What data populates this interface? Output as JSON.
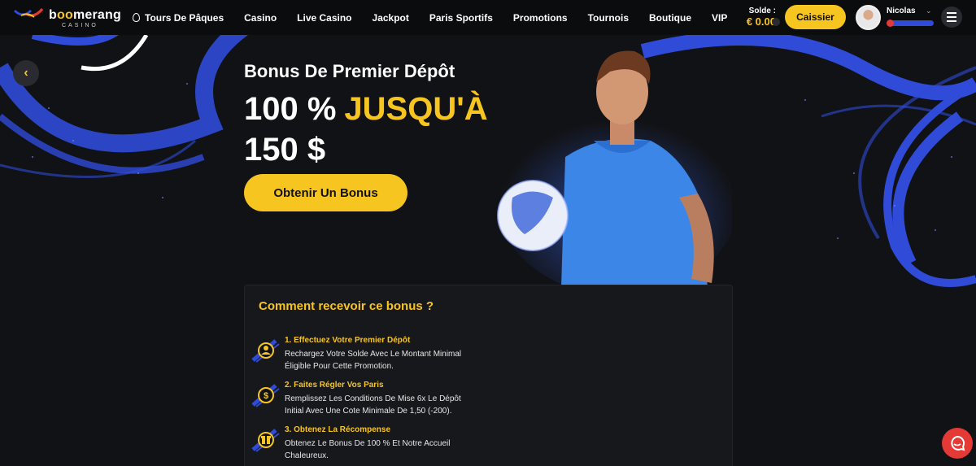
{
  "brand": {
    "name_prefix": "b",
    "name_o": "oo",
    "name_rest": "merang",
    "sub": "CASINO"
  },
  "nav": {
    "items": [
      {
        "label": "Tours De Pâques",
        "icon": "easter-egg-icon"
      },
      {
        "label": "Casino"
      },
      {
        "label": "Live Casino"
      },
      {
        "label": "Jackpot"
      },
      {
        "label": "Paris Sportifs"
      },
      {
        "label": "Promotions"
      },
      {
        "label": "Tournois"
      },
      {
        "label": "Boutique"
      },
      {
        "label": "VIP"
      }
    ]
  },
  "account": {
    "balance_label": "Solde :",
    "balance_value": "€ 0.00",
    "cashier_label": "Caissier",
    "username": "Nicolas",
    "level_progress": 0.0
  },
  "hero": {
    "subtitle": "Bonus De Premier Dépôt",
    "headline_a": "100 %",
    "headline_b": "JUSQU'À",
    "headline_c": "150 $",
    "cta_label": "Obtenir Un Bonus"
  },
  "howto": {
    "title": "Comment recevoir ce bonus ?",
    "steps": [
      {
        "title": "1. Effectuez Votre Premier Dépôt",
        "desc": "Rechargez Votre Solde Avec Le Montant Minimal Éligible Pour Cette Promotion.",
        "icon": "user-deposit-icon"
      },
      {
        "title": "2. Faites Régler Vos Paris",
        "desc": "Remplissez Les Conditions De Mise 6x Le Dépôt Initial Avec Une Cote Minimale De 1,50 (-200).",
        "icon": "dollar-coin-icon"
      },
      {
        "title": "3. Obtenez La Récompense",
        "desc": "Obtenez Le Bonus De 100 % Et Notre Accueil Chaleureux.",
        "icon": "gift-icon"
      }
    ]
  },
  "colors": {
    "accent": "#f7c520",
    "background": "#111215",
    "swoosh": "#2f4bd8",
    "chat": "#e53935"
  }
}
